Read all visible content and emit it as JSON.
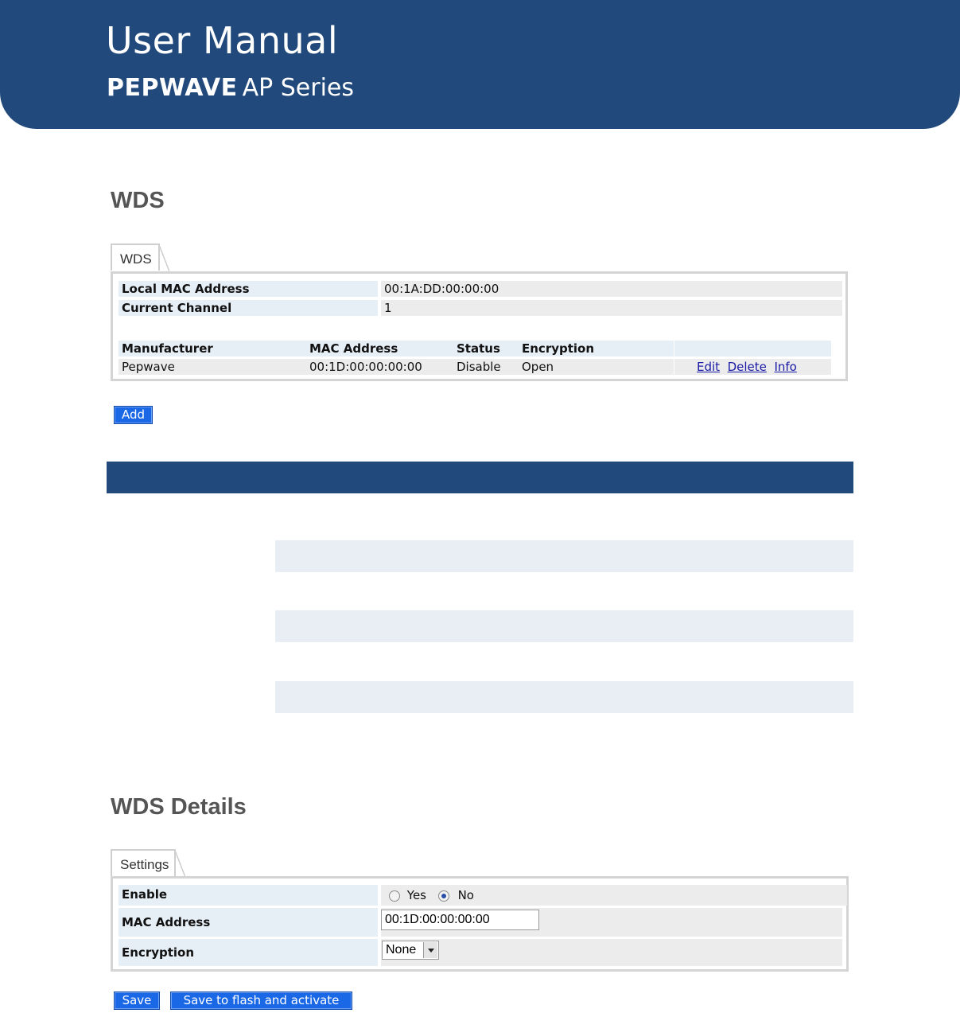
{
  "header": {
    "title": "User Manual",
    "brand": "PEPWAVE",
    "series": "AP Series"
  },
  "wds_section": {
    "heading": "WDS",
    "tab_label": "WDS",
    "local_mac_label": "Local MAC Address",
    "local_mac_value": "00:1A:DD:00:00:00",
    "channel_label": "Current Channel",
    "channel_value": "1",
    "table": {
      "headers": [
        "Manufacturer",
        "MAC Address",
        "Status",
        "Encryption"
      ],
      "rows": [
        {
          "manufacturer": "Pepwave",
          "mac": "00:1D:00:00:00:00",
          "status": "Disable",
          "encryption": "Open",
          "actions": [
            "Edit",
            "Delete",
            "Info"
          ]
        }
      ]
    },
    "add_button": "Add"
  },
  "details_section": {
    "heading": "WDS Details",
    "tab_label": "Settings",
    "enable_label": "Enable",
    "enable_options": [
      "Yes",
      "No"
    ],
    "enable_selected": "No",
    "mac_label": "MAC Address",
    "mac_value": "00:1D:00:00:00:00",
    "encryption_label": "Encryption",
    "encryption_value": "None",
    "save_button": "Save",
    "save_activate_button": "Save to flash and activate"
  },
  "colors": {
    "brand_blue": "#21497b",
    "button_blue": "#1a68e6",
    "label_bg": "#e6eef6",
    "value_bg": "#ececec"
  }
}
